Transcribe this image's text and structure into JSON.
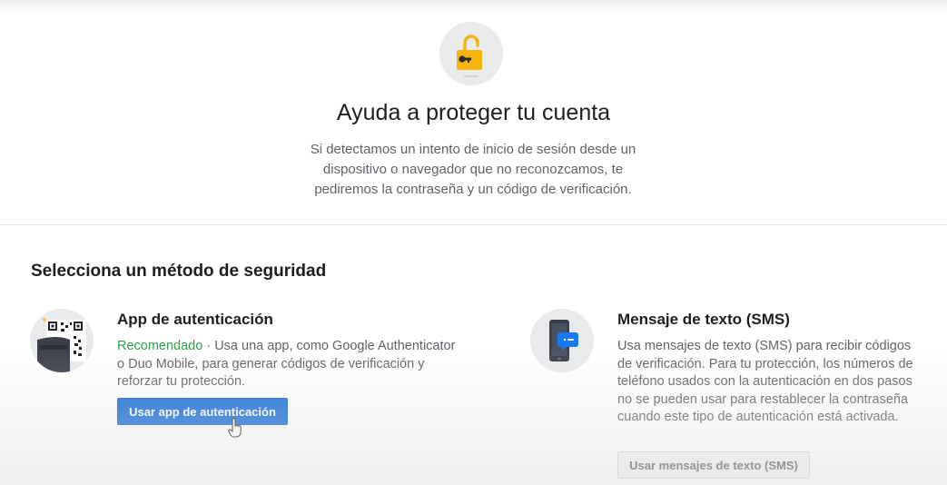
{
  "header": {
    "title": "Ayuda a proteger tu cuenta",
    "description": "Si detectamos un intento de inicio de sesión desde un dispositivo o navegador que no reconozcamos, te pediremos la contraseña y un código de verificación."
  },
  "section": {
    "title": "Selecciona un método de seguridad"
  },
  "methods": {
    "app": {
      "title": "App de autenticación",
      "recommended": "Recomendado",
      "description": " · Usa una app, como Google Authenticator o Duo Mobile, para generar códigos de verificación y reforzar tu protección.",
      "button": "Usar app de autenticación",
      "icon": "qr-code-icon"
    },
    "sms": {
      "title": "Mensaje de texto (SMS)",
      "description": "Usa mensajes de texto (SMS) para recibir códigos de verificación. Para tu protección, los números de teléfono usados con la autenticación en dos pasos no se pueden usar para restablecer la contraseña cuando este tipo de autenticación está activada.",
      "button": "Usar mensajes de texto (SMS)",
      "icon": "phone-message-icon"
    }
  },
  "colors": {
    "primary": "#1a6ed8",
    "recommended": "#2ba14a",
    "lock": "#f5b50f"
  }
}
